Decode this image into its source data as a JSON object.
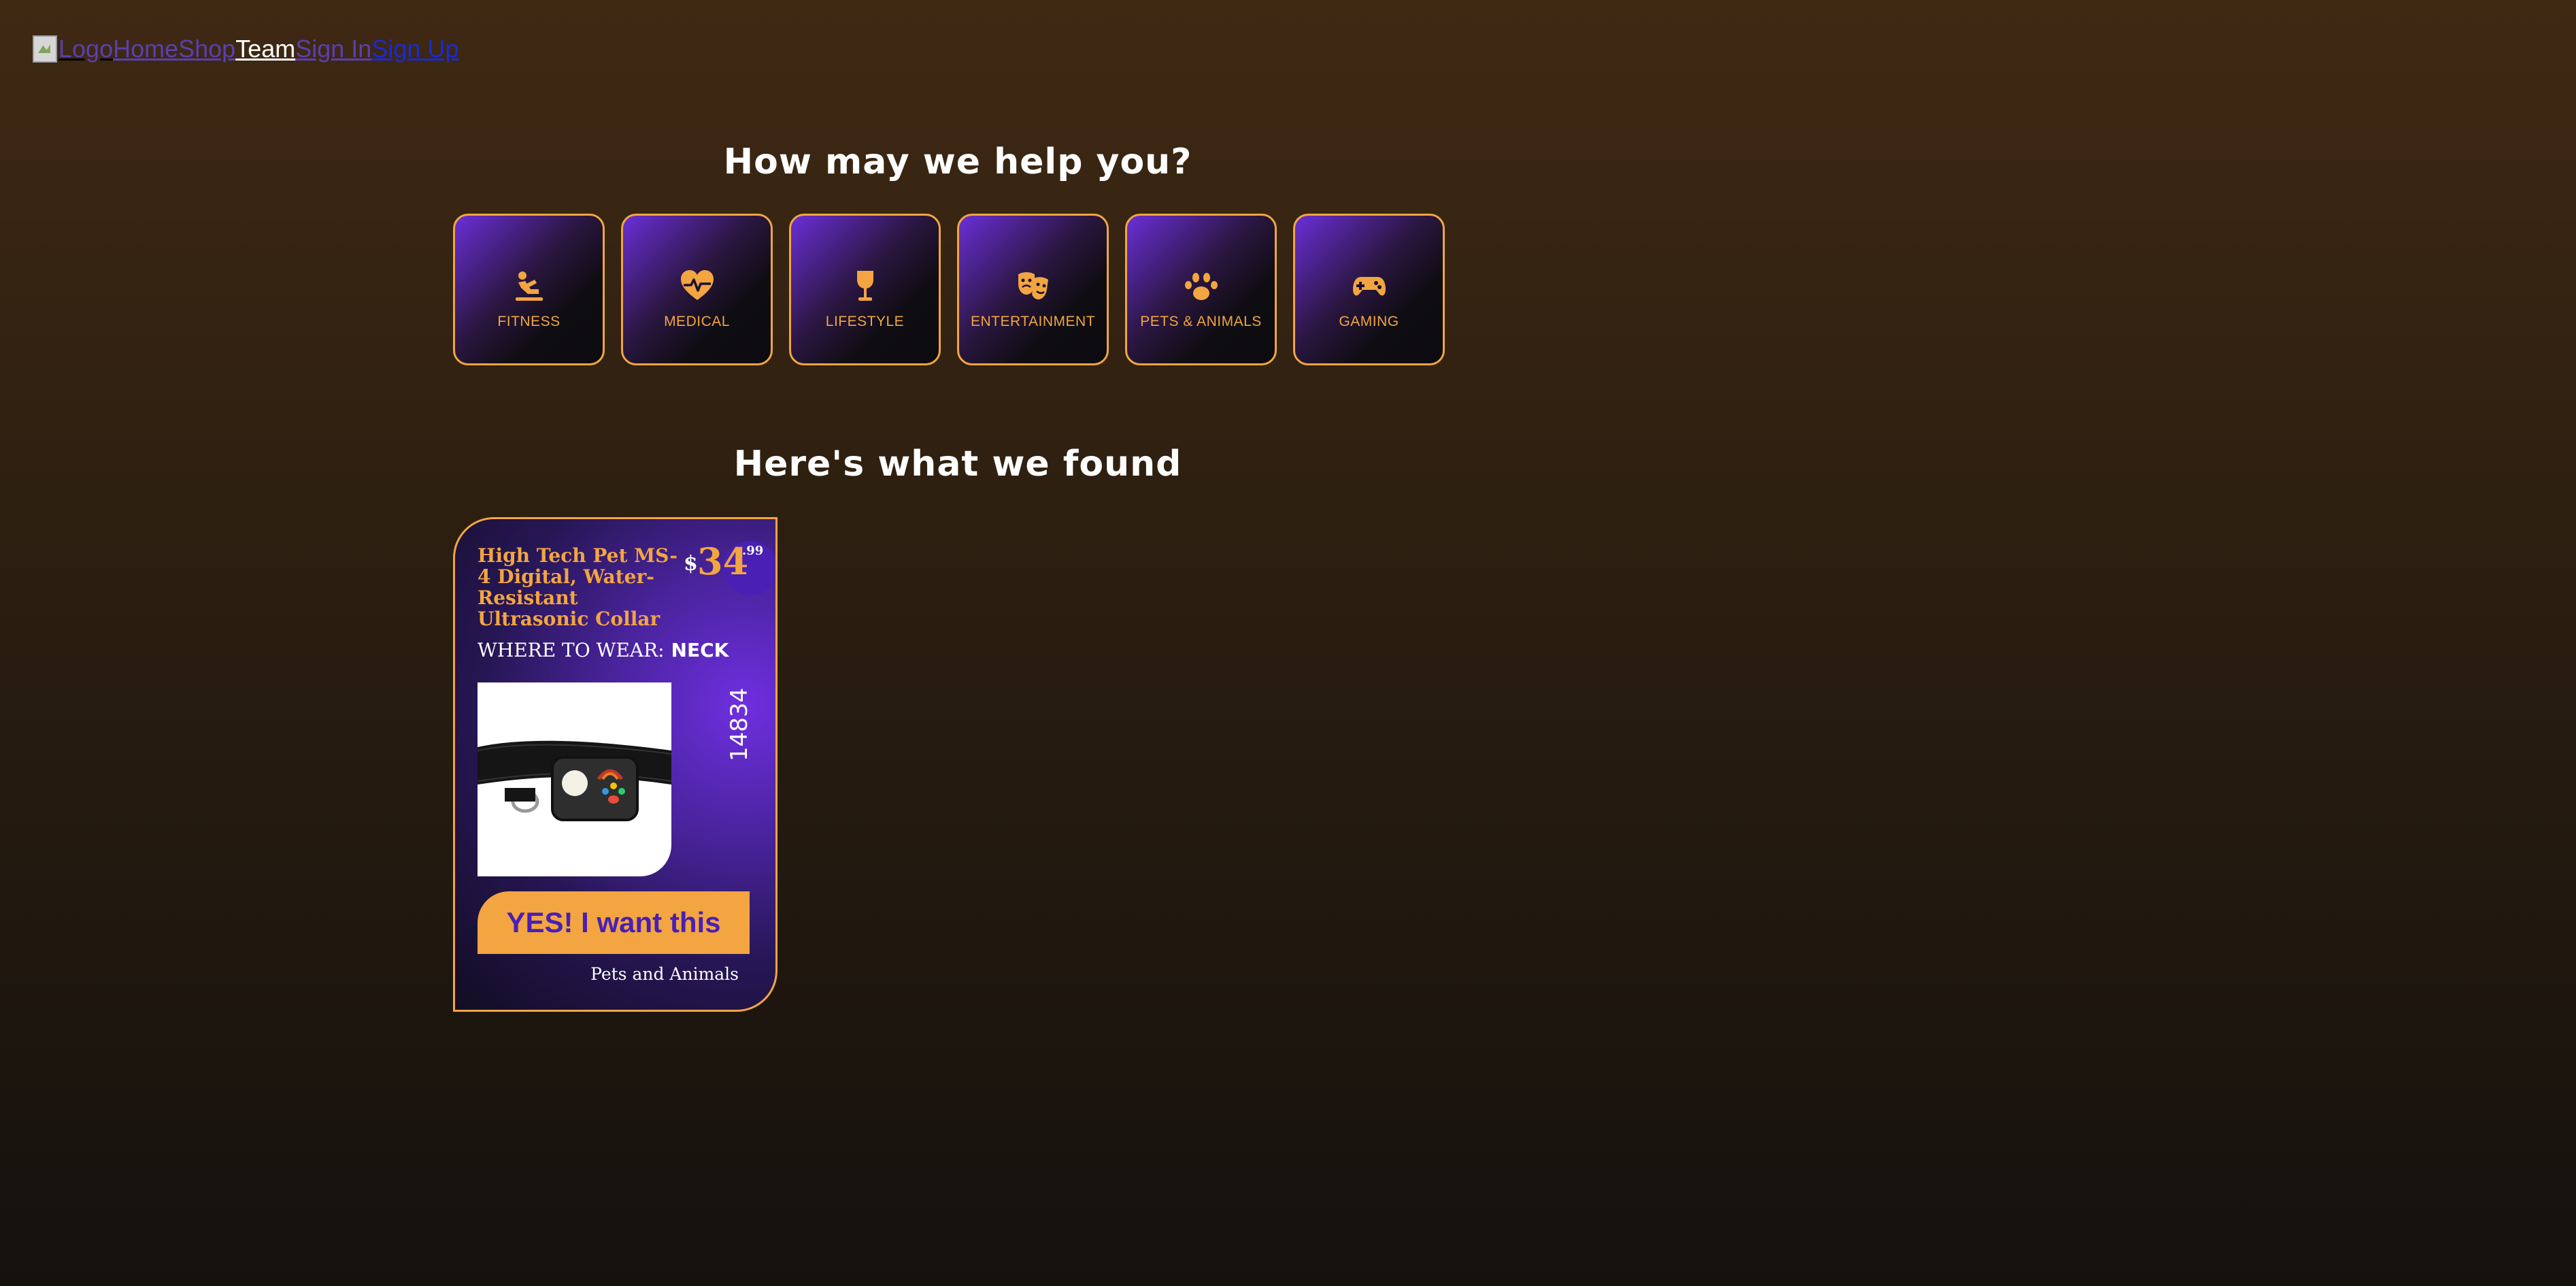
{
  "nav": {
    "logo_alt": "Logo",
    "links": [
      {
        "label": "Home"
      },
      {
        "label": "Shop"
      },
      {
        "label": "Team"
      },
      {
        "label": "Sign In"
      },
      {
        "label": "Sign Up"
      }
    ]
  },
  "help_heading": "How may we help you?",
  "categories": [
    {
      "label": "FITNESS",
      "icon": "situp-icon"
    },
    {
      "label": "MEDICAL",
      "icon": "heart-pulse-icon"
    },
    {
      "label": "LIFESTYLE",
      "icon": "wine-glass-icon"
    },
    {
      "label": "ENTERTAINMENT",
      "icon": "theater-masks-icon"
    },
    {
      "label": "PETS & ANIMALS",
      "icon": "paw-icon"
    },
    {
      "label": "GAMING",
      "icon": "gamepad-icon"
    }
  ],
  "results_heading": "Here's what we found",
  "product": {
    "title": "High Tech Pet MS-4 Digital, Water-Resistant Ultrasonic Collar",
    "price_symbol": "$",
    "price_whole": "34",
    "price_cents": ".99",
    "where_label": "WHERE TO WEAR:",
    "where_value": "NECK",
    "sku": "14834",
    "cta": "YES! I want this",
    "category": "Pets and Animals"
  },
  "colors": {
    "accent": "#f2a541",
    "purple": "#4a1fb3",
    "background_top": "#3f2913",
    "background_bottom": "#15110d"
  }
}
